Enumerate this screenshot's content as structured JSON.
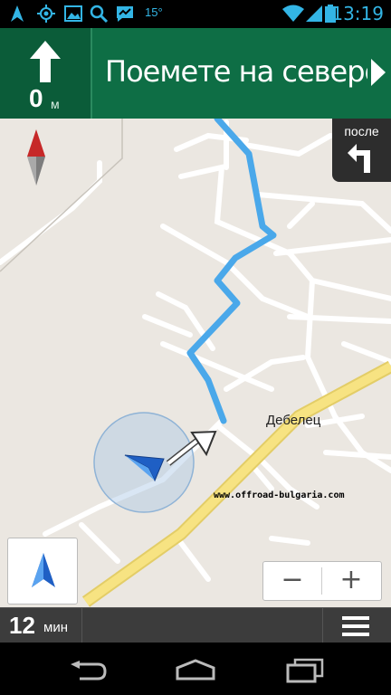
{
  "status_bar": {
    "time": "13:19",
    "temperature": "15°",
    "left_icons": [
      "navigation-arrow-icon",
      "gps-icon",
      "gallery-icon",
      "search-icon",
      "chat-icon"
    ],
    "right_icons": [
      "wifi-icon",
      "signal-icon",
      "battery-icon"
    ]
  },
  "instruction_panel": {
    "turn_icon": "straight-arrow-icon",
    "distance_value": "0",
    "distance_unit": "м",
    "instruction_text": "Поемете на североизток"
  },
  "next_turn": {
    "label": "после",
    "icon": "turn-left-icon"
  },
  "map": {
    "place_label": "Дебелец",
    "watermark": "www.offroad-bulgaria.com",
    "route_color": "#4aa8ea",
    "highway_color": "#f7e382"
  },
  "controls": {
    "zoom_out_label": "−",
    "zoom_in_label": "+"
  },
  "bottom_bar": {
    "eta_value": "12",
    "eta_unit": "мин"
  }
}
